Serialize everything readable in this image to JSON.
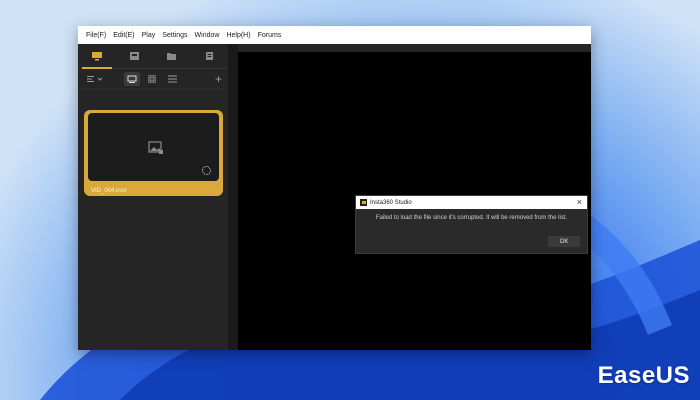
{
  "menubar": {
    "items": [
      "File(F)",
      "Edit(E)",
      "Play",
      "Settings",
      "Window",
      "Help(H)",
      "Forums"
    ]
  },
  "sidebar": {
    "tabs": [
      {
        "icon": "media-icon",
        "active": true
      },
      {
        "icon": "album-icon",
        "active": false
      },
      {
        "icon": "folder-icon",
        "active": false
      },
      {
        "icon": "edit-doc-icon",
        "active": false
      }
    ],
    "card": {
      "filename": "VID_004.insv"
    }
  },
  "dialog": {
    "title": "Insta360 Studio",
    "message": "Failed to load the file since it's corrupted. It will be removed from the list.",
    "ok_label": "OK"
  },
  "brand": {
    "text": "EaseUS"
  },
  "colors": {
    "accent": "#d9a93a",
    "app_bg": "#1e1e1e",
    "preview_bg": "#000000"
  }
}
